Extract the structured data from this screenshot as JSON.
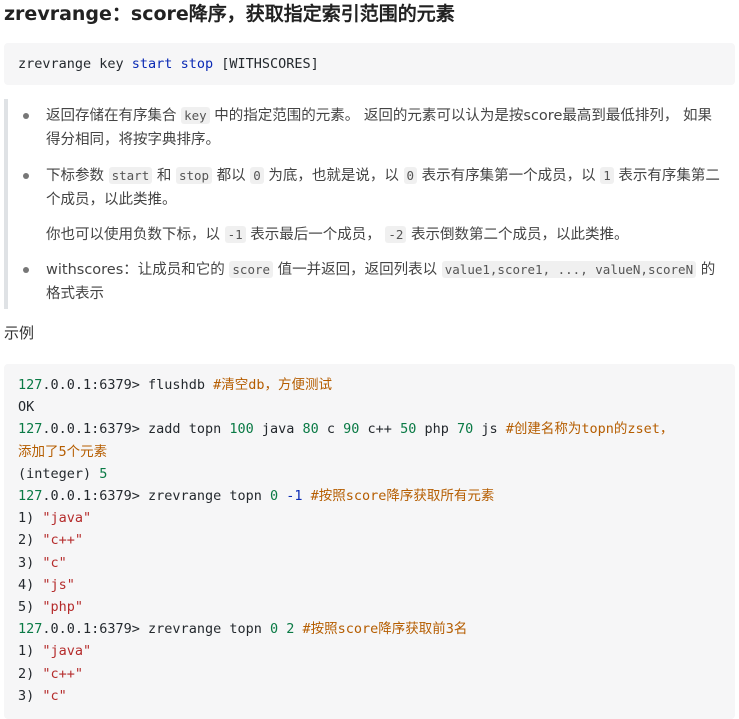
{
  "title": "zrevrange：score降序，获取指定索引范围的元素",
  "syntax": {
    "cmd": "zrevrange key ",
    "start": "start",
    "space": " ",
    "stop": "stop",
    "rest": " [WITHSCORES]"
  },
  "items": {
    "i1": {
      "a": "返回存储在有序集合 ",
      "code": "key",
      "b": " 中的指定范围的元素。 返回的元素可以认为是按score最高到最低排列， 如果得分相同，将按字典排序。"
    },
    "i2": {
      "a": "下标参数 ",
      "c1": "start",
      "b": " 和 ",
      "c2": "stop",
      "c": " 都以 ",
      "c3": "0",
      "d": " 为底，也就是说，以 ",
      "c4": "0",
      "e": " 表示有序集第一个成员，以 ",
      "c5": "1",
      "f": " 表示有序集第二个成员，以此类推。",
      "p2a": "你也可以使用负数下标，以 ",
      "p2c1": "-1",
      "p2b": " 表示最后一个成员， ",
      "p2c2": "-2",
      "p2c": " 表示倒数第二个成员，以此类推。"
    },
    "i3": {
      "a": "withscores：让成员和它的 ",
      "c1": "score",
      "b": " 值一并返回，返回列表以 ",
      "c2": "value1,score1, ..., valueN,scoreN",
      "c": " 的格式表示"
    }
  },
  "example_label": "示例",
  "example": {
    "l1": {
      "n": "127",
      "p": ".0.0.1:6379> flushdb ",
      "cm": "#清空db，方便测试"
    },
    "l2": "OK",
    "l3": {
      "n": "127",
      "p": ".0.0.1:6379> zadd topn ",
      "n1": "100",
      "t1": " java ",
      "n2": "80",
      "t2": " c ",
      "n3": "90",
      "t3": " c++ ",
      "n4": "50",
      "t4": " php ",
      "n5": "70",
      "t5": " js ",
      "cm": "#创建名称为topn的zset，"
    },
    "l4": "添加了5个元素",
    "l5": {
      "p": "(integer) ",
      "n": "5"
    },
    "l6": {
      "n": "127",
      "p": ".0.0.1:6379> zrevrange topn ",
      "n1": "0",
      "sp": " ",
      "n2": "-1",
      "sp2": " ",
      "cm": "#按照score降序获取所有元素"
    },
    "r1": [
      {
        "i": "1) ",
        "s": "\"java\""
      },
      {
        "i": "2) ",
        "s": "\"c++\""
      },
      {
        "i": "3) ",
        "s": "\"c\""
      },
      {
        "i": "4) ",
        "s": "\"js\""
      },
      {
        "i": "5) ",
        "s": "\"php\""
      }
    ],
    "l7": {
      "n": "127",
      "p": ".0.0.1:6379> zrevrange topn ",
      "n1": "0",
      "sp": " ",
      "n2": "2",
      "sp2": " ",
      "cm": "#按照score降序获取前3名"
    },
    "r2": [
      {
        "i": "1) ",
        "s": "\"java\""
      },
      {
        "i": "2) ",
        "s": "\"c++\""
      },
      {
        "i": "3) ",
        "s": "\"c\""
      }
    ]
  }
}
